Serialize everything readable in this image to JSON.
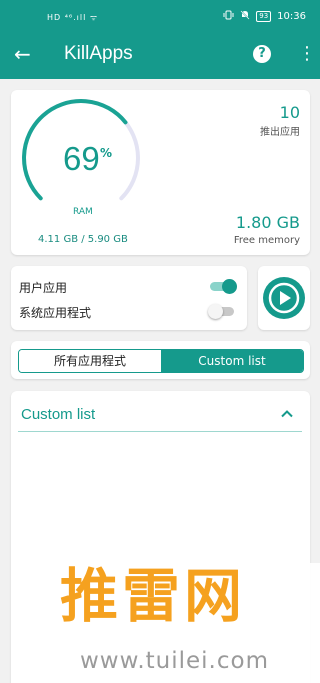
{
  "status_bar": {
    "left": "HD ⁴⁶.ıll ᯤ",
    "right_icons": [
      "vibrate-icon",
      "bell-off-icon",
      "battery-icon"
    ],
    "battery": "93",
    "time": "10:36"
  },
  "appbar": {
    "title": "KillApps",
    "back_icon": "←",
    "help_icon": "?",
    "more_icon": "⋮"
  },
  "ram": {
    "percent": "69",
    "percent_sign": "%",
    "percent_value": 0.69,
    "label": "RAM",
    "usage": "4.11 GB / 5.90 GB"
  },
  "stats": {
    "exit_count": "10",
    "exit_label": "推出应用",
    "free_value": "1.80 GB",
    "free_label": "Free memory"
  },
  "toggles": {
    "user_apps_label": "用户应用",
    "user_apps_on": true,
    "system_apps_label": "系统应用程式",
    "system_apps_on": false
  },
  "tabs": {
    "all": "所有应用程式",
    "custom": "Custom list",
    "selected": "custom"
  },
  "list": {
    "title": "Custom list"
  },
  "watermark": {
    "text": "推雷网",
    "url": "www.tuilei.com"
  },
  "colors": {
    "accent": "#159a8c",
    "background": "#f1f1f1",
    "watermark": "#f5a11f"
  }
}
